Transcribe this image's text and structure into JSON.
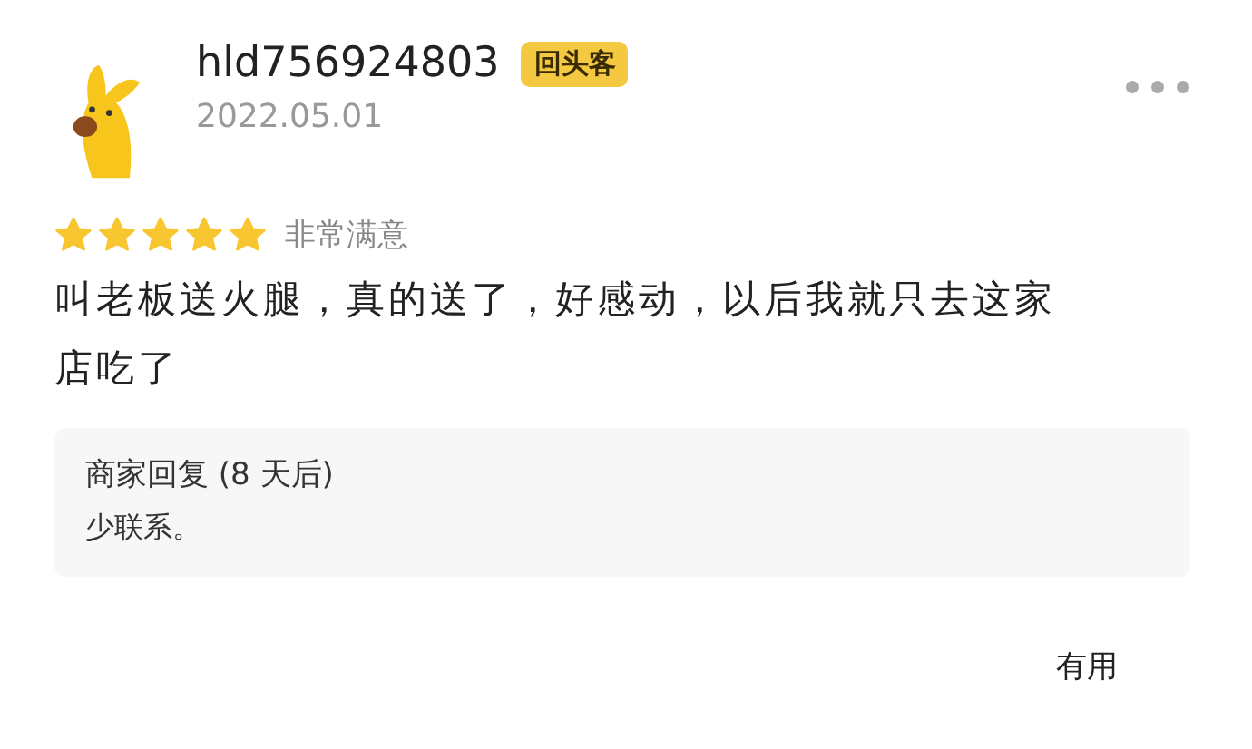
{
  "review": {
    "username": "hld756924803",
    "badge": "回头客",
    "date": "2022.05.01",
    "stars": 5,
    "rating_label": "非常满意",
    "text": "叫老板送火腿，真的送了，好感动，以后我就只去这家店吃了"
  },
  "reply": {
    "title": "商家回复 (8 天后)",
    "text": "少联系。"
  },
  "helpful": {
    "label": "有用"
  }
}
